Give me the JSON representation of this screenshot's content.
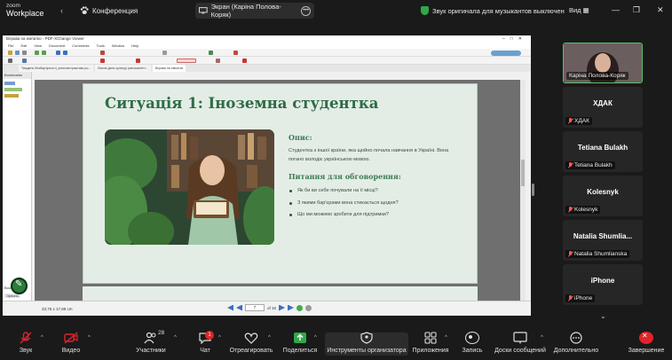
{
  "topbar": {
    "app_line1": "zoom",
    "app_line2": "Workplace",
    "conference_label": "Конференция",
    "screen_share_label": "Экран (Каріна Полова-Коряк)",
    "notice_text": "Звук оригинала для музыкантов выключен",
    "view_label": "Вид"
  },
  "pdf_viewer": {
    "window_title": "Вправа на емпатію - PDF-XChange Viewer",
    "menu": [
      "File",
      "Edit",
      "View",
      "Document",
      "Comments",
      "Tools",
      "Window",
      "Help"
    ],
    "tabs": [
      "Тиждень безбар'єрності_ключові практики ро...",
      "Всеов день культур різноманітті...",
      "Вправа на емпатію"
    ],
    "left_panel_label": "Bookmarks",
    "left_panel_bottom": "Bookmarks",
    "options_label": "Options",
    "dimensions": "33,75 x 17,89 cm",
    "page_current": "7",
    "page_total": "of 16"
  },
  "slide": {
    "title": "Ситуація 1: Іноземна студентка",
    "desc_heading": "Опис:",
    "desc_text": "Студентка з іншої країни, яка щойно почала навчання в Україні. Вона погано володіє українською мовою.",
    "questions_heading": "Питання для обговорення:",
    "questions": [
      "Як би ви себе почували на її місці?",
      "З якими бар'єрами вона стикається щодня?",
      "Що ми можемо зробити для підтримки?"
    ]
  },
  "participants": [
    {
      "tile_name": "",
      "label": "Каріна Полова-Коряк",
      "muted": false,
      "video": true
    },
    {
      "tile_name": "ХДАК",
      "label": "ХДАК",
      "muted": true,
      "video": false
    },
    {
      "tile_name": "Tetiana Bulakh",
      "label": "Tetiana Bulakh",
      "muted": true,
      "video": false
    },
    {
      "tile_name": "Kolesnyk",
      "label": "Kolesnyk",
      "muted": true,
      "video": false
    },
    {
      "tile_name": "Natalia  Shumlia...",
      "label": "Natalia Shumlianska",
      "muted": true,
      "video": false
    },
    {
      "tile_name": "iPhone",
      "label": "iPhone",
      "muted": true,
      "video": false
    }
  ],
  "toolbar": {
    "audio": "Звук",
    "video": "Видео",
    "participants": "Участники",
    "participants_count": "28",
    "chat": "Чат",
    "chat_badge": "1",
    "react": "Отреагировать",
    "share": "Поделиться",
    "host_tools": "Инструменты организатора",
    "apps": "Приложения",
    "record": "Запись",
    "whiteboards": "Доски сообщений",
    "more": "Дополнительно",
    "end": "Завершение"
  },
  "colors": {
    "zoom_bg": "#1a1a1a",
    "slide_bg": "#e3ede5",
    "slide_title": "#2f6c47",
    "share_green": "#2ea84a",
    "end_red": "#e0242a"
  }
}
